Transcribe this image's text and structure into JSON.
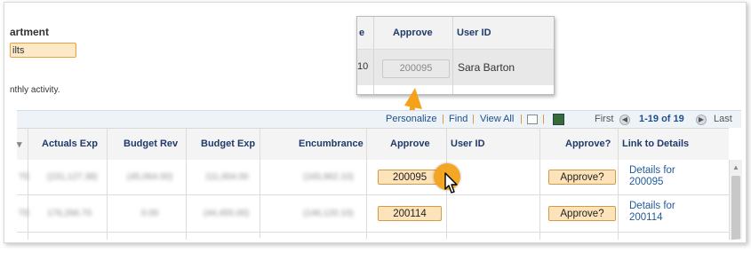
{
  "left": {
    "dept_label_partial": "artment",
    "dept_value_partial": "ilts",
    "note_partial": "nthly activity."
  },
  "zoom": {
    "col_trunc": "e",
    "col_approve": "Approve",
    "col_userid": "User ID",
    "row_trunc": "10",
    "approve_value": "200095",
    "user_name": "Sara Barton"
  },
  "toolbar": {
    "personalize": "Personalize",
    "find": "Find",
    "view_all": "View All",
    "first": "First",
    "range": "1-19 of 19",
    "last": "Last"
  },
  "columns": [
    "Actuals Exp",
    "Budget Rev",
    "Budget Exp",
    "Encumbrance",
    "Approve",
    "User ID",
    "Approve?",
    "Link to Details"
  ],
  "rows": [
    {
      "approve": "200095",
      "approve_q": "Approve?",
      "details_line1": "Details for",
      "details_line2": "200095"
    },
    {
      "approve": "200114",
      "approve_q": "Approve?",
      "details_line1": "Details for",
      "details_line2": "200114"
    }
  ],
  "blurred_values": {
    "row1": [
      "(231,127.38)",
      "(45,064.00)",
      "111,004.00",
      "(165,962.10)"
    ],
    "row2": [
      "176,266.70",
      "0.00",
      "(44,455.00)",
      "(146,120.10)"
    ]
  },
  "colors": {
    "accent_orange": "#f4a21a",
    "button_bg": "#fde3ba",
    "link_blue": "#1f5a9c",
    "header_text": "#1f3a6b"
  }
}
